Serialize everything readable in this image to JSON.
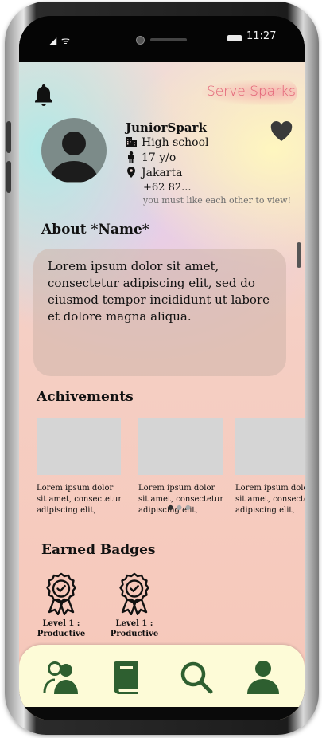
{
  "status_bar": {
    "signal": "◢ ᯤ",
    "time": "11:27"
  },
  "app": {
    "name": "Serve Sparks"
  },
  "profile": {
    "name": "JuniorSpark",
    "school": "High school",
    "age": "17 y/o",
    "location": "Jakarta",
    "phone": "+62 82...",
    "phone_hint": "you must like each other to view!"
  },
  "about": {
    "title": "About *Name*",
    "text": "Lorem ipsum dolor sit amet, consectetur adipiscing elit, sed do eiusmod tempor incididunt ut labore et dolore magna aliqua."
  },
  "achievements": {
    "title": "Achivements",
    "items": [
      {
        "line1": "Lorem ipsum dolor",
        "line2": "sit amet, consectetur",
        "line3": "adipiscing elit,"
      },
      {
        "line1": "Lorem ipsum dolor",
        "line2": "sit amet, consectetur",
        "line3": "adipiscing elit,"
      },
      {
        "line1": "Lorem ipsum dolor",
        "line2": "sit amet, consectetur",
        "line3": "adipiscing elit,"
      }
    ],
    "page_indicator": {
      "pages": 3,
      "current": 1
    }
  },
  "badges": {
    "title": "Earned Badges",
    "items": [
      {
        "line1": "Level 1 :",
        "line2": "Productive",
        "icon": "award-badge-icon"
      },
      {
        "line1": "Level 1 :",
        "line2": "Productive",
        "icon": "award-badge-icon"
      }
    ]
  },
  "nav": {
    "items": [
      "friends-icon",
      "book-icon",
      "search-icon",
      "profile-icon"
    ],
    "color": "#2e5f30"
  },
  "colors": {
    "brand": "#e25d73",
    "nav_bg": "#fdfbd7",
    "card": "#cdb4aa"
  }
}
